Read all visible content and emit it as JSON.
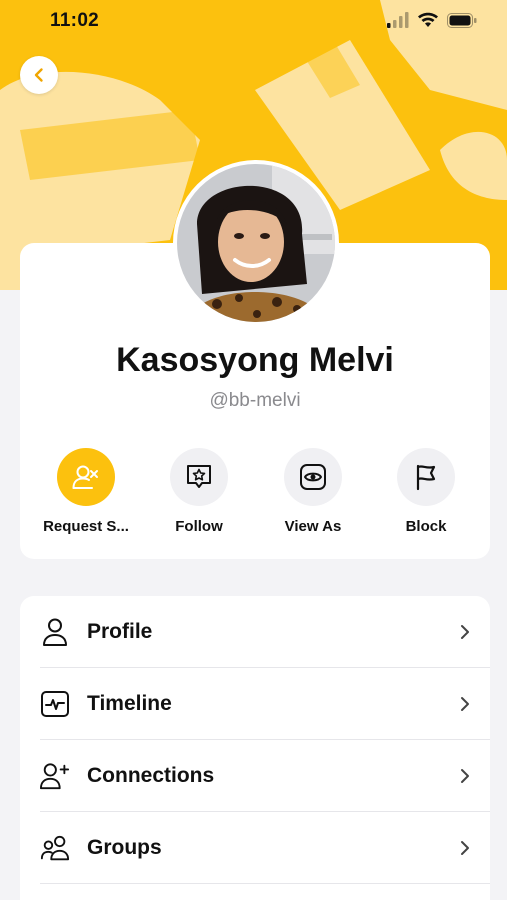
{
  "status_bar": {
    "time": "11:02"
  },
  "profile": {
    "display_name": "Kasosyong Melvi",
    "username": "@bb-melvi"
  },
  "actions": [
    {
      "label": "Request S...",
      "icon": "user-x-icon"
    },
    {
      "label": "Follow",
      "icon": "star-message-icon"
    },
    {
      "label": "View As",
      "icon": "eye-icon"
    },
    {
      "label": "Block",
      "icon": "flag-icon"
    }
  ],
  "menu": [
    {
      "label": "Profile",
      "icon": "user-icon"
    },
    {
      "label": "Timeline",
      "icon": "activity-icon"
    },
    {
      "label": "Connections",
      "icon": "user-plus-icon"
    },
    {
      "label": "Groups",
      "icon": "users-icon"
    }
  ],
  "colors": {
    "accent": "#fcc10e",
    "cover_shape": "#fde3a0",
    "card": "#ffffff",
    "page_bg": "#f3f3f6"
  }
}
